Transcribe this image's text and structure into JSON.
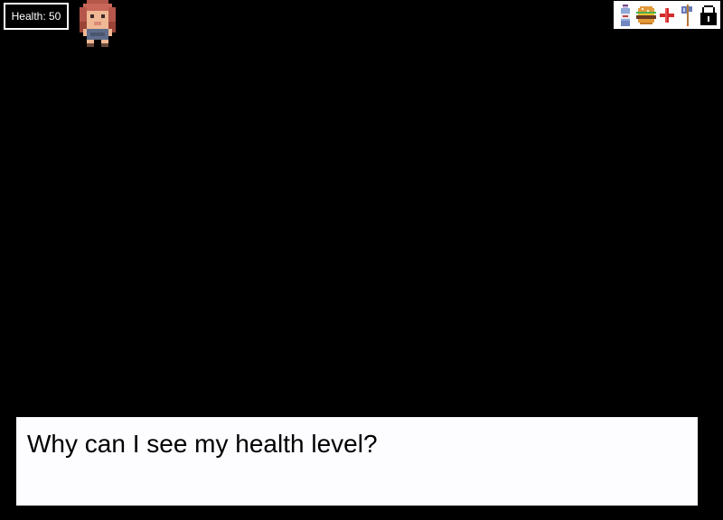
{
  "hud": {
    "health_label": "Health: 50",
    "health_value": 50
  },
  "player": {
    "sprite_icon": "girl-character-sprite"
  },
  "inventory": {
    "items": [
      {
        "icon": "water-bottle-icon"
      },
      {
        "icon": "burger-icon"
      },
      {
        "icon": "medical-cross-icon"
      },
      {
        "icon": "axe-icon"
      },
      {
        "icon": "padlock-icon"
      }
    ]
  },
  "dialogue": {
    "text": "Why can I see my health level?"
  },
  "colors": {
    "background": "#000000",
    "hud_border": "#ffffff",
    "dialogue_bg": "#fdfcff",
    "medkit_red": "#d42a2a",
    "burger_bun": "#e39a3a"
  }
}
